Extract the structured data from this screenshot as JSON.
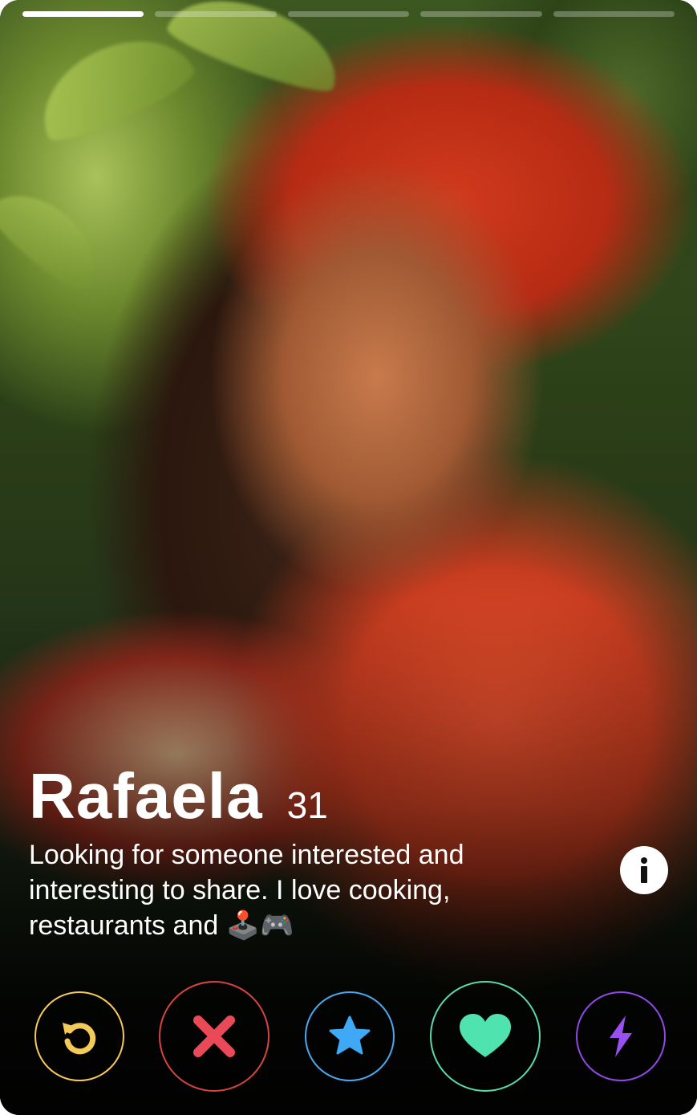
{
  "profile": {
    "name": "Rafaela",
    "age": "31",
    "bio": "Looking for someone interested and interesting to share. I love cooking, restaurants and 🕹️🎮"
  },
  "photos": {
    "count": 5,
    "active_index": 0
  },
  "icons": {
    "info": "info-icon",
    "rewind": "rewind-icon",
    "nope": "close-icon",
    "super_like": "star-icon",
    "like": "heart-icon",
    "boost": "lightning-icon"
  },
  "colors": {
    "rewind": "#f5cb58",
    "nope": "#ea4a57",
    "super_like": "#3fa9f5",
    "like": "#4fe3b0",
    "boost": "#9a4ff0",
    "nope_ring": "#d6453f",
    "super_like_ring": "#4aa8ee",
    "like_ring": "#58dcaa",
    "boost_ring": "#8f49e6"
  }
}
